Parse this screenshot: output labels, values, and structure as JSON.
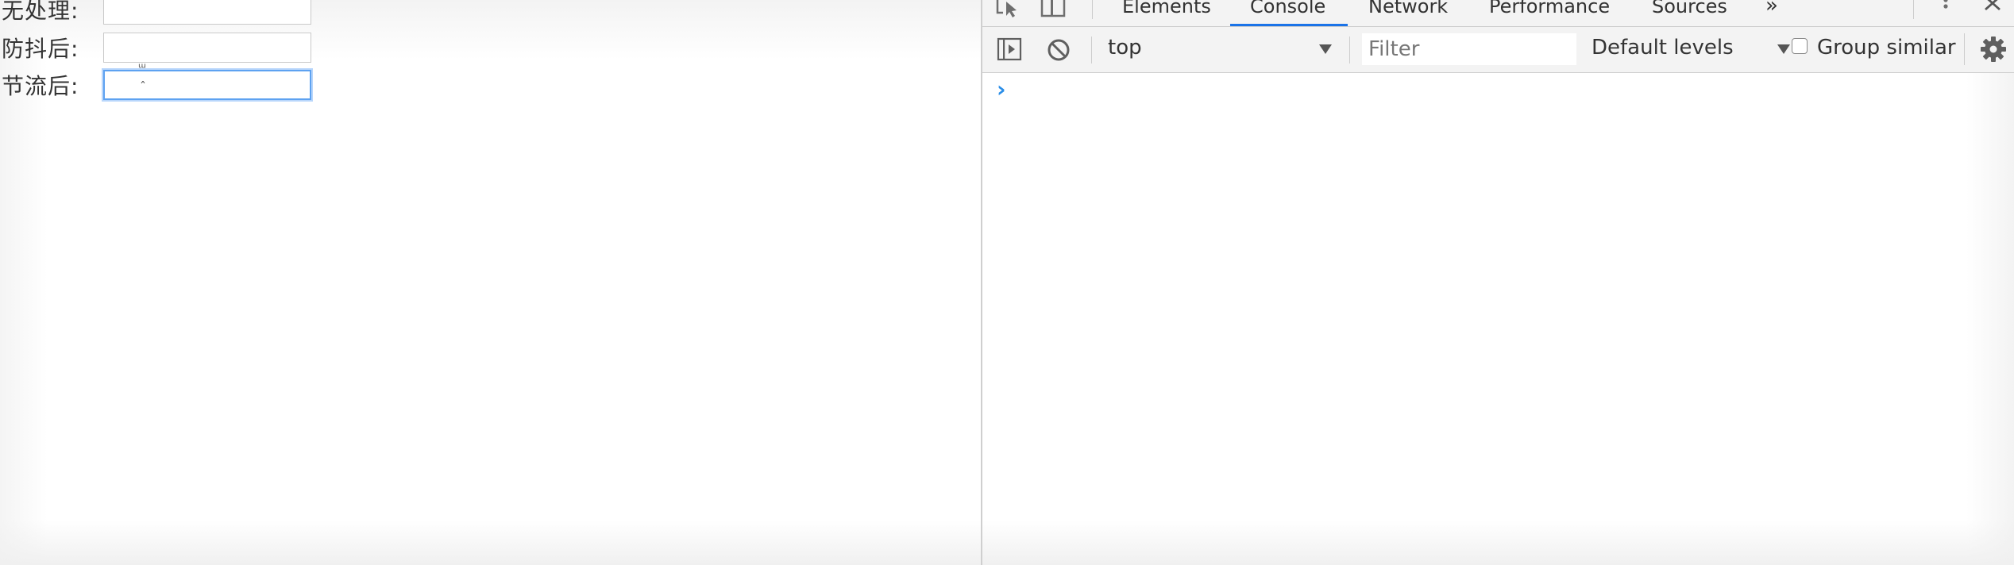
{
  "form": {
    "rows": [
      {
        "label": "无处理:",
        "value": ""
      },
      {
        "label": "防抖后:",
        "value": ""
      },
      {
        "label": "节流后:",
        "value": ""
      }
    ]
  },
  "devtools": {
    "tabs": [
      "Elements",
      "Console",
      "Network",
      "Performance",
      "Sources"
    ],
    "active_tab": "Console",
    "more_tabs": "»",
    "toolbar": {
      "context": "top",
      "filter_placeholder": "Filter",
      "levels": "Default levels",
      "group_similar": "Group similar"
    },
    "prompt": "›",
    "colors": {
      "accent": "#1a73e8",
      "prompt": "#2a8ee8",
      "focus_ring": "#5ea2f1"
    }
  },
  "icons": [
    "inspect-element-icon",
    "device-toggle-icon",
    "more-options-icon",
    "close-icon",
    "sidebar-toggle-icon",
    "clear-console-icon",
    "dropdown-arrow-icon",
    "settings-gear-icon"
  ]
}
